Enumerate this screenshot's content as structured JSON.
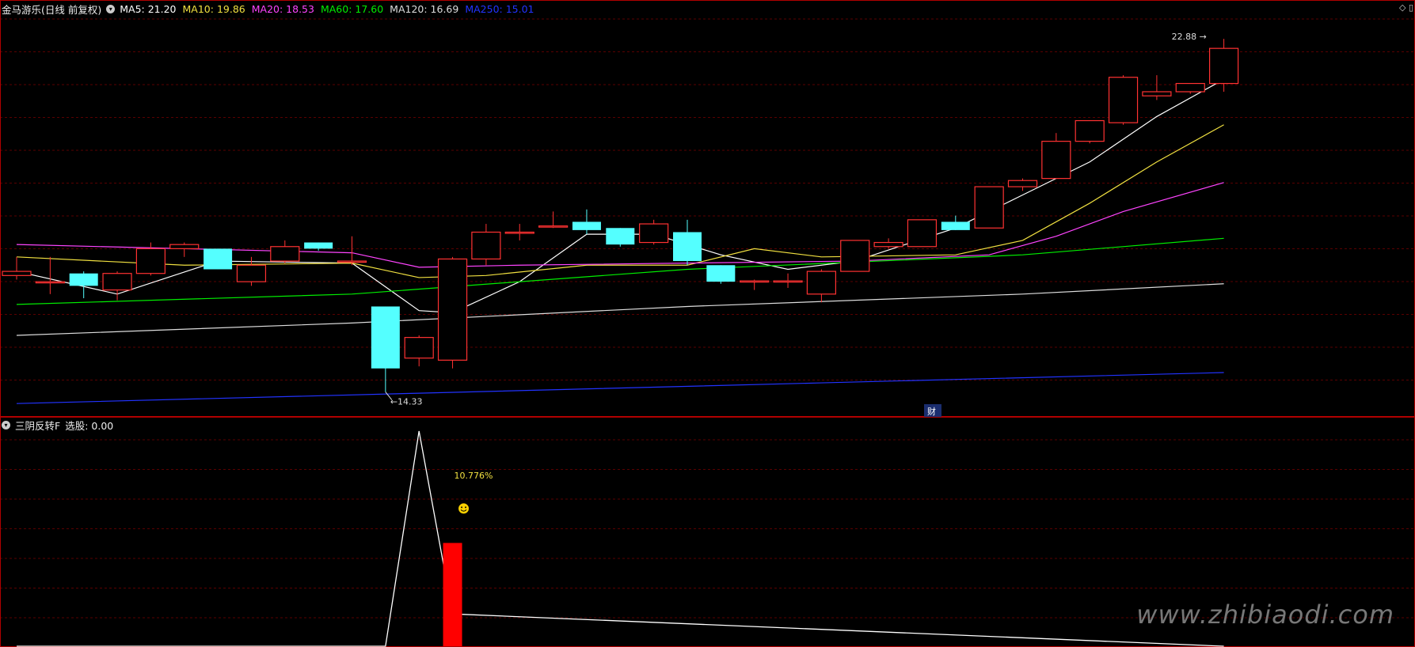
{
  "main_panel": {
    "stock_name": "金马游乐",
    "period": "(日线 前复权)",
    "ma_legend": [
      {
        "label": "MA5: 21.20",
        "color": "#ffffff"
      },
      {
        "label": "MA10: 19.86",
        "color": "#f0e040"
      },
      {
        "label": "MA20: 18.53",
        "color": "#ff44ff"
      },
      {
        "label": "MA60: 17.60",
        "color": "#00ee00"
      },
      {
        "label": "MA120: 16.69",
        "color": "#dddddd"
      },
      {
        "label": "MA250: 15.01",
        "color": "#2233ff"
      }
    ],
    "high_label": "22.88",
    "low_label": "14.33",
    "finance_marker": "财"
  },
  "sub_panel": {
    "indicator_name": "三阴反转F",
    "stock_pick_label": "选股: 0.00",
    "signal_text": "10.776%"
  },
  "watermark": "www.zhibiaodi.com",
  "colors": {
    "up": "#ff3232",
    "down": "#54ffff",
    "grid": "#5a0000",
    "border": "#b00000"
  },
  "chart_data": {
    "type": "candlestick",
    "price_range": [
      13.9,
      23.4
    ],
    "candles": [
      {
        "o": 17.15,
        "h": 17.6,
        "l": 17.05,
        "c": 17.25
      },
      {
        "o": 17.0,
        "h": 17.6,
        "l": 16.7,
        "c": 17.0
      },
      {
        "o": 17.2,
        "h": 17.25,
        "l": 16.6,
        "c": 16.9
      },
      {
        "o": 16.8,
        "h": 17.25,
        "l": 16.55,
        "c": 17.2
      },
      {
        "o": 17.2,
        "h": 17.95,
        "l": 17.15,
        "c": 17.8
      },
      {
        "o": 17.8,
        "h": 17.95,
        "l": 17.6,
        "c": 17.9
      },
      {
        "o": 17.8,
        "h": 17.8,
        "l": 17.3,
        "c": 17.3
      },
      {
        "o": 17.0,
        "h": 17.6,
        "l": 16.9,
        "c": 17.4
      },
      {
        "o": 17.5,
        "h": 18.0,
        "l": 17.45,
        "c": 17.85
      },
      {
        "o": 17.95,
        "h": 17.95,
        "l": 17.75,
        "c": 17.8
      },
      {
        "o": 17.5,
        "h": 18.1,
        "l": 17.4,
        "c": 17.5
      },
      {
        "o": 16.4,
        "h": 16.4,
        "l": 14.33,
        "c": 14.9
      },
      {
        "o": 15.15,
        "h": 15.7,
        "l": 14.95,
        "c": 15.65
      },
      {
        "o": 15.1,
        "h": 17.6,
        "l": 14.9,
        "c": 17.55
      },
      {
        "o": 17.55,
        "h": 18.4,
        "l": 17.4,
        "c": 18.2
      },
      {
        "o": 18.2,
        "h": 18.4,
        "l": 18.0,
        "c": 18.2
      },
      {
        "o": 18.35,
        "h": 18.7,
        "l": 18.3,
        "c": 18.35
      },
      {
        "o": 18.45,
        "h": 18.75,
        "l": 18.15,
        "c": 18.25
      },
      {
        "o": 18.3,
        "h": 18.3,
        "l": 17.85,
        "c": 17.9
      },
      {
        "o": 17.95,
        "h": 18.5,
        "l": 17.9,
        "c": 18.4
      },
      {
        "o": 18.2,
        "h": 18.5,
        "l": 17.4,
        "c": 17.5
      },
      {
        "o": 17.4,
        "h": 17.4,
        "l": 16.95,
        "c": 17.0
      },
      {
        "o": 17.02,
        "h": 17.05,
        "l": 16.8,
        "c": 17.02
      },
      {
        "o": 17.02,
        "h": 17.2,
        "l": 16.85,
        "c": 17.02
      },
      {
        "o": 16.7,
        "h": 17.3,
        "l": 16.5,
        "c": 17.25
      },
      {
        "o": 17.25,
        "h": 18.0,
        "l": 17.25,
        "c": 18.0
      },
      {
        "o": 17.85,
        "h": 18.05,
        "l": 17.8,
        "c": 17.95
      },
      {
        "o": 17.85,
        "h": 18.5,
        "l": 17.85,
        "c": 18.5
      },
      {
        "o": 18.45,
        "h": 18.6,
        "l": 18.25,
        "c": 18.25
      },
      {
        "o": 18.3,
        "h": 19.3,
        "l": 18.3,
        "c": 19.3
      },
      {
        "o": 19.3,
        "h": 19.5,
        "l": 19.2,
        "c": 19.45
      },
      {
        "o": 19.5,
        "h": 20.6,
        "l": 19.5,
        "c": 20.4
      },
      {
        "o": 20.4,
        "h": 20.9,
        "l": 20.35,
        "c": 20.9
      },
      {
        "o": 20.85,
        "h": 22.0,
        "l": 20.8,
        "c": 21.95
      },
      {
        "o": 21.5,
        "h": 22.0,
        "l": 21.4,
        "c": 21.6
      },
      {
        "o": 21.6,
        "h": 21.8,
        "l": 21.55,
        "c": 21.8
      },
      {
        "o": 21.8,
        "h": 22.88,
        "l": 21.6,
        "c": 22.65
      }
    ],
    "ma_series": [
      {
        "color": "#ffffff",
        "points": [
          [
            0,
            17.25
          ],
          [
            3,
            16.7
          ],
          [
            6,
            17.5
          ],
          [
            10,
            17.45
          ],
          [
            12,
            16.3
          ],
          [
            13,
            16.25
          ],
          [
            15,
            17.0
          ],
          [
            17,
            18.15
          ],
          [
            19,
            18.15
          ],
          [
            21,
            17.65
          ],
          [
            23,
            17.3
          ],
          [
            25,
            17.5
          ],
          [
            28,
            18.3
          ],
          [
            30,
            19.1
          ],
          [
            32,
            19.9
          ],
          [
            34,
            21.0
          ],
          [
            36,
            21.9
          ]
        ]
      },
      {
        "color": "#f0e040",
        "points": [
          [
            0,
            17.6
          ],
          [
            5,
            17.4
          ],
          [
            10,
            17.45
          ],
          [
            12,
            17.1
          ],
          [
            14,
            17.15
          ],
          [
            17,
            17.4
          ],
          [
            20,
            17.4
          ],
          [
            22,
            17.8
          ],
          [
            24,
            17.6
          ],
          [
            28,
            17.65
          ],
          [
            30,
            18.0
          ],
          [
            32,
            18.9
          ],
          [
            34,
            19.9
          ],
          [
            36,
            20.8
          ]
        ]
      },
      {
        "color": "#ff44ff",
        "points": [
          [
            0,
            17.9
          ],
          [
            5,
            17.8
          ],
          [
            10,
            17.7
          ],
          [
            12,
            17.35
          ],
          [
            15,
            17.4
          ],
          [
            20,
            17.45
          ],
          [
            25,
            17.5
          ],
          [
            29,
            17.65
          ],
          [
            31,
            18.1
          ],
          [
            33,
            18.7
          ],
          [
            36,
            19.4
          ]
        ]
      },
      {
        "color": "#00ee00",
        "points": [
          [
            0,
            16.45
          ],
          [
            10,
            16.7
          ],
          [
            20,
            17.3
          ],
          [
            30,
            17.65
          ],
          [
            36,
            18.05
          ]
        ]
      },
      {
        "color": "#dddddd",
        "points": [
          [
            0,
            15.7
          ],
          [
            10,
            16.0
          ],
          [
            20,
            16.4
          ],
          [
            30,
            16.7
          ],
          [
            36,
            16.95
          ]
        ]
      },
      {
        "color": "#2233ff",
        "points": [
          [
            0,
            14.05
          ],
          [
            12,
            14.3
          ],
          [
            24,
            14.55
          ],
          [
            36,
            14.8
          ]
        ]
      }
    ],
    "indicator": {
      "line_points": [
        [
          0,
          0
        ],
        [
          11,
          0
        ],
        [
          12,
          1
        ],
        [
          13,
          0.15
        ],
        [
          36,
          0
        ]
      ],
      "bar_index": 13,
      "bar_value": 0.48,
      "range": [
        0,
        1
      ]
    }
  }
}
